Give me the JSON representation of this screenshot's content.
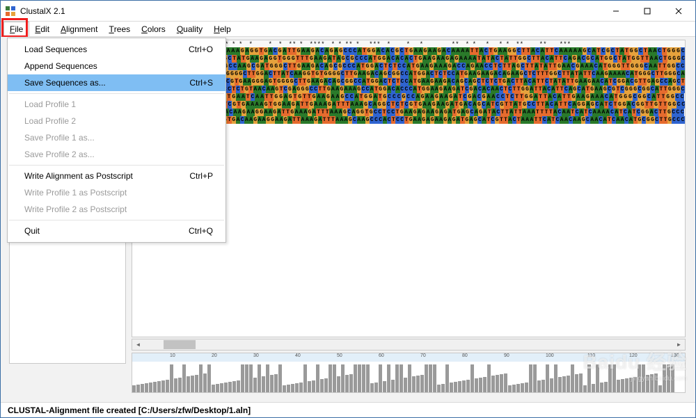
{
  "window": {
    "title": "ClustalX 2.1"
  },
  "menubar": {
    "items": [
      {
        "label": "File",
        "accel": "F",
        "active": true
      },
      {
        "label": "Edit",
        "accel": "E",
        "active": false
      },
      {
        "label": "Alignment",
        "accel": "A",
        "active": false
      },
      {
        "label": "Trees",
        "accel": "T",
        "active": false
      },
      {
        "label": "Colors",
        "accel": "C",
        "active": false
      },
      {
        "label": "Quality",
        "accel": "Q",
        "active": false
      },
      {
        "label": "Help",
        "accel": "H",
        "active": false
      }
    ]
  },
  "file_menu": {
    "items": [
      {
        "label": "Load Sequences",
        "shortcut": "Ctrl+O",
        "enabled": true,
        "highlighted": false
      },
      {
        "label": "Append Sequences",
        "shortcut": "",
        "enabled": true,
        "highlighted": false
      },
      {
        "label": "Save Sequences as...",
        "shortcut": "Ctrl+S",
        "enabled": true,
        "highlighted": true
      },
      {
        "label": "Load Profile 1",
        "shortcut": "",
        "enabled": false,
        "highlighted": false
      },
      {
        "label": "Load Profile 2",
        "shortcut": "",
        "enabled": false,
        "highlighted": false
      },
      {
        "label": "Save Profile 1 as...",
        "shortcut": "",
        "enabled": false,
        "highlighted": false
      },
      {
        "label": "Save Profile 2 as...",
        "shortcut": "",
        "enabled": false,
        "highlighted": false
      },
      {
        "label": "Write Alignment as Postscript",
        "shortcut": "Ctrl+P",
        "enabled": true,
        "highlighted": false
      },
      {
        "label": "Write Profile 1 as Postscript",
        "shortcut": "",
        "enabled": false,
        "highlighted": false
      },
      {
        "label": "Write Profile 2 as Postscript",
        "shortcut": "",
        "enabled": false,
        "highlighted": false
      },
      {
        "label": "Quit",
        "shortcut": "Ctrl+Q",
        "enabled": true,
        "highlighted": false
      }
    ],
    "separators_after": [
      2,
      6,
      9
    ]
  },
  "alignment": {
    "conservation": "         *  *   * *       *** * *  *     *  *  ** *  ****  * * ** *   ***  *     *   *         **  * *   *   * *  **     **    ***",
    "sequences": [
      "CACCGTCTCCGAACAGAAAGAAAGAGGTGACGATTGAAGACAGAGCCCATGGACACGCTGAAGAAGACAAAATTACTGAAGGCTTACATTCAAAAAGCATCGCTATGGCTAACTGGGC",
      "CACCGTCTCCGGTTTAATGGGCTATGAAGAGGTGGGTTTGAAGATAGCGCCCATGGACACACTGAAGAAGAGAAAATATACTATTGGCTTACATTCAGACGCATGGCTATGGTTAACTGGGC",
      "------ATGCGTCGTCAGCCGCCAAGCGATGGGCTTGAAGACAGCGCCCATGGACTCTCCATGAAGAAAGACCAGAACCTCTTAGCTTATATTGAACGAAACATGGGTTGGGCAATTGGCC",
      "CACCATCTCCTCATGTAGCGATGGGGCTTGGACTTATCAAGGTGTGGGGCTTGAAGACAGCGGCCATGGACTCTCCATGAAGAAGACAGAAGCTCTTTGGCTTATATTCAAGAAAACATGGGCTTGGGCAATTGGGC",
      "CACCGTCTCCTCATGTAGCGATCGTGAAGGGAGTGGGGCTTGAAGACAGCGGCCATGGACTCTCCATGAAGAAGACAGCAGCTCTCTGACTTACATTCTATATTGAAGAACATCGGACGTTGAGCCAGCT",
      "GGGCGTGGTCTCACTGTCCATCCTCTGTAACAAGTCGAGGGCCTTGAAGAAAGCCATGGACACCCATGGAAGAAGATCGACACAACTCTTGGATTACATTCAGCATGAAGCGTCGGGCGGCATTGGGC",
      "GGCGTCTCCTCATGTAGCTGTGAATCAATTGGAGTGTTGAAGAAGCCATGGATGCCCGCCAGAAGAAGATCGACGAACCTCTTGGATTACATTGAAGAAACATGGGCGGCATTGGCC",
      "CGCCATCTCCTCATCTATGATCGTGAAAAGTGGAAGATTGAAAGATTTAAAGCAGGCTCTCGTGAAGAAGATGACAGCATCGTTATGCCTTACATTCAGGAGCATCTGGACGGTTGTTGGCC",
      "CGCCGACTCTCGCATGTTGTGACAAGAAGGAAGATTGAAAGATTTAAAGCAGGTGCCTCCTGAAGAGAAGAGATGAGCAGATACTTATTAAATTTTACAATCATCAAAACATCATCGGACTTGCCC",
      "CGCCGACACTCCGCGGATGTTGTGACAAGAAGGAAGATTAAAGATTTAAAGCAAGCCCACTCCTGAAGAGAAGAGATGAGCATCGTTACTAAATTCATCAACAAGCAACATCAACATGCGGCTTGCCC"
    ]
  },
  "ruler": {
    "tick_start": 10,
    "tick_step": 10,
    "tick_count": 13
  },
  "status": {
    "text": "CLUSTAL-Alignment file created  [C:/Users/zfw/Desktop/1.aln]"
  },
  "watermark": {
    "brand": "Baidu 经验",
    "sub": "jingyan.baidu.com"
  }
}
